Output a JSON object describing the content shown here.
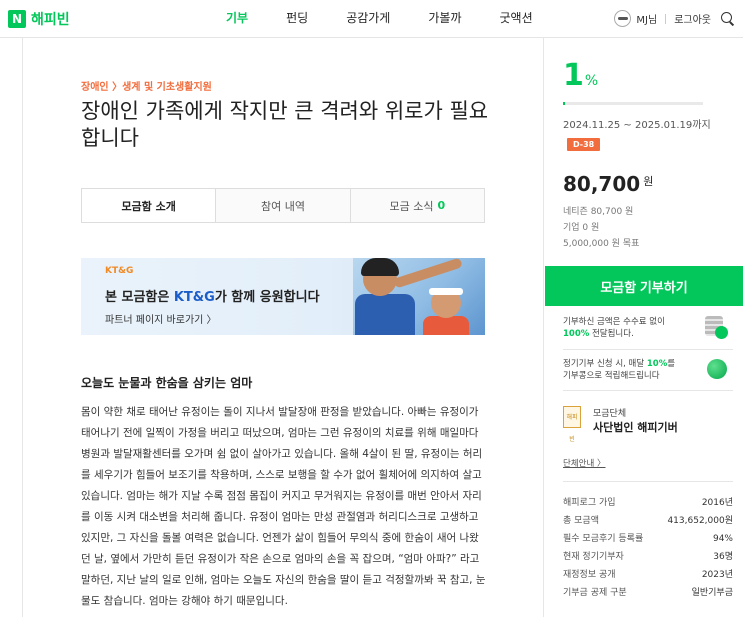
{
  "nav": {
    "logo_mark": "N",
    "logo_text": "해피빈",
    "menu": [
      "기부",
      "펀딩",
      "공감가게",
      "가볼까",
      "굿액션"
    ],
    "user_name": "MJ님",
    "logout": "로그아웃"
  },
  "campaign": {
    "category": "장애인 〉생계 및 기초생활지원",
    "title": "장애인 가족에게 작지만 큰 격려와 위로가 필요합니다",
    "tabs": {
      "intro": "모금함 소개",
      "history": "참여 내역",
      "news": "모금 소식",
      "news_count": "0"
    },
    "banner": {
      "logo_left": "KT&G",
      "main_prefix": "본 모금함은 ",
      "main_highlight": "KT&G",
      "main_suffix": "가 함께 응원합니다",
      "link": "파트너 페이지 바로가기 〉"
    },
    "story_heading": "오늘도 눈물과 한숨을 삼키는 엄마",
    "story": "몸이 약한 채로 태어난 유정이는 돌이 지나서 발달장애 판정을 받았습니다. 아빠는 유정이가 태어나기 전에 일찍이 가정을 버리고 떠났으며, 엄마는 그런 유정이의 치료를 위해 매일마다 병원과 발달재활센터를 오가며 쉼 없이 살아가고 있습니다. 올해 4살이 된 딸, 유정이는 허리를 세우기가 힘들어 보조기를 착용하며, 스스로 보행을 할 수가 없어 휠체어에 의지하여 살고 있습니다. 엄마는 해가 지날 수록 점점 몸집이 커지고 무거워지는 유정이를 매번 안아서 자리를 이동 시켜 대소변을 처리해 줍니다. 유정이 엄마는 만성 관절염과 허리디스크로 고생하고 있지만, 그 자신을 돌볼 여력은 없습니다. 언젠가 삶이 힘들어 무의식 중에 한숨이 새어 나왔던 날, 옆에서 가만히 듣던 유정이가 작은 손으로 엄마의 손을 꼭 잡으며, “엄마 아파?” 라고 말하던, 지난 날의 일로 인해, 엄마는 오늘도 자신의 한숨을 딸이 듣고 걱정할까봐 꾹 참고, 눈물도 참습니다. 엄마는 강해야 하기 때문입니다."
  },
  "sidebar": {
    "percent": "1",
    "percent_unit": "%",
    "progress_fraction": 0.016,
    "period": "2024.11.25 ~ 2025.01.19까지",
    "dday": "D-38",
    "amount": "80,700",
    "amount_unit": "원",
    "netizen": "네티즌 80,700 원",
    "company": "기업 0 원",
    "goal": "5,000,000 원 목표",
    "donate_button": "모금함 기부하기",
    "info1_line1": "기부하신 금액은 수수료 없이",
    "info1_bold": "100%",
    "info1_line2": " 전달됩니다.",
    "info2_line1_prefix": "정기기부 신청 시, 매달 ",
    "info2_bold": "10%",
    "info2_line1_suffix": "를",
    "info2_line2": "기부콩으로 적립해드립니다",
    "org_logo": "해피빈",
    "org_type": "모금단체",
    "org_name": "사단법인 해피기버",
    "org_intro": "단체안내 〉",
    "stats": [
      {
        "label": "해피로그 가입",
        "value": "2016년"
      },
      {
        "label": "총 모금액",
        "value": "413,652,000원"
      },
      {
        "label": "필수 모금후기 등록률",
        "value": "94%"
      },
      {
        "label": "현재 정기기부자",
        "value": "36명"
      },
      {
        "label": "재정정보 공개",
        "value": "2023년"
      },
      {
        "label": "기부금 공제 구분",
        "value": "일반기부금"
      }
    ]
  },
  "colors": {
    "brand_green": "#03c75a",
    "accent_orange": "#f26d3d",
    "banner_blue": "#1b5ec9"
  }
}
